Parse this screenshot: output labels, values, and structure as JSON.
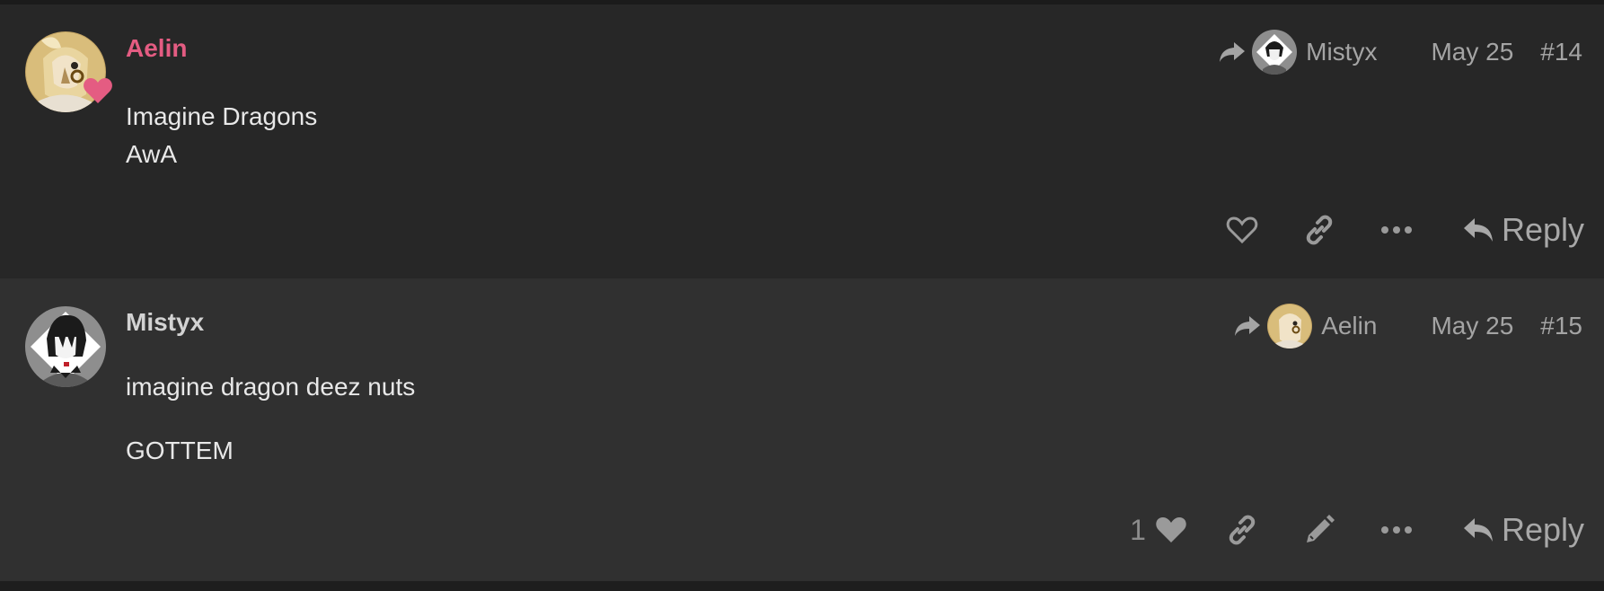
{
  "posts": [
    {
      "author": "Aelin",
      "reply_to": "Mistyx",
      "date": "May 25",
      "number": "#14",
      "body": [
        "Imagine Dragons",
        "AwA"
      ],
      "actions": {
        "like_count": "",
        "reply_label": "Reply"
      }
    },
    {
      "author": "Mistyx",
      "reply_to": "Aelin",
      "date": "May 25",
      "number": "#15",
      "body": [
        "imagine dragon deez nuts",
        "GOTTEM"
      ],
      "actions": {
        "like_count": "1",
        "reply_label": "Reply"
      }
    }
  ],
  "colors": {
    "page_bg": "#222222",
    "post_bg_1": "#272727",
    "post_bg_2": "#303030",
    "author_highlight": "#e45c82",
    "author_normal": "#d2d2d2",
    "muted_text": "#a4a4a4",
    "body_text": "#e8e8e8",
    "flair_heart": "#e45c82"
  },
  "icons": {
    "reply_arrow": "share-arrow-icon",
    "like": "heart-outline-icon",
    "liked": "heart-filled-icon",
    "link": "link-icon",
    "more": "ellipsis-icon",
    "edit": "pencil-icon",
    "reply": "reply-icon",
    "flair": "heart-flair-icon"
  }
}
